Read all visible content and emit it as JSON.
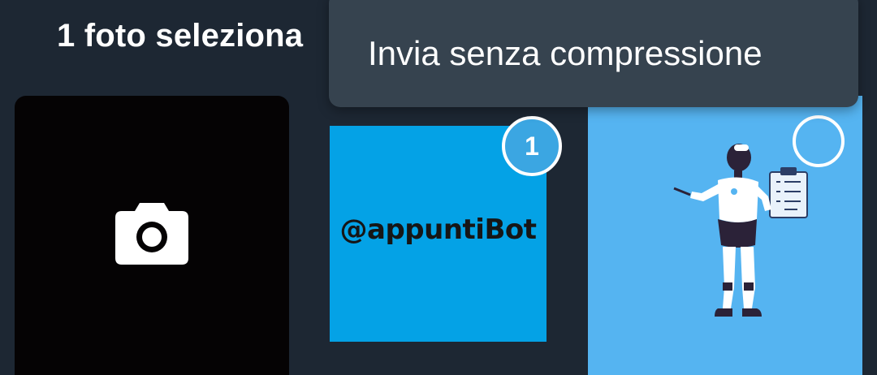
{
  "header": {
    "title": "1 foto seleziona"
  },
  "popup_menu": {
    "items": [
      {
        "label": "Invia senza compressione",
        "icon": null
      }
    ]
  },
  "gallery": {
    "tiles": [
      {
        "type": "camera",
        "icon": "camera-icon"
      },
      {
        "type": "photo",
        "text": "@appuntiBot",
        "selected": true,
        "selection_index": "1",
        "background": "#04a2e6"
      },
      {
        "type": "photo",
        "selected": false,
        "background": "#55b4f1"
      }
    ]
  },
  "colors": {
    "background": "#1d2733",
    "menu_background": "#36434f",
    "badge": "#3ba6e2"
  }
}
